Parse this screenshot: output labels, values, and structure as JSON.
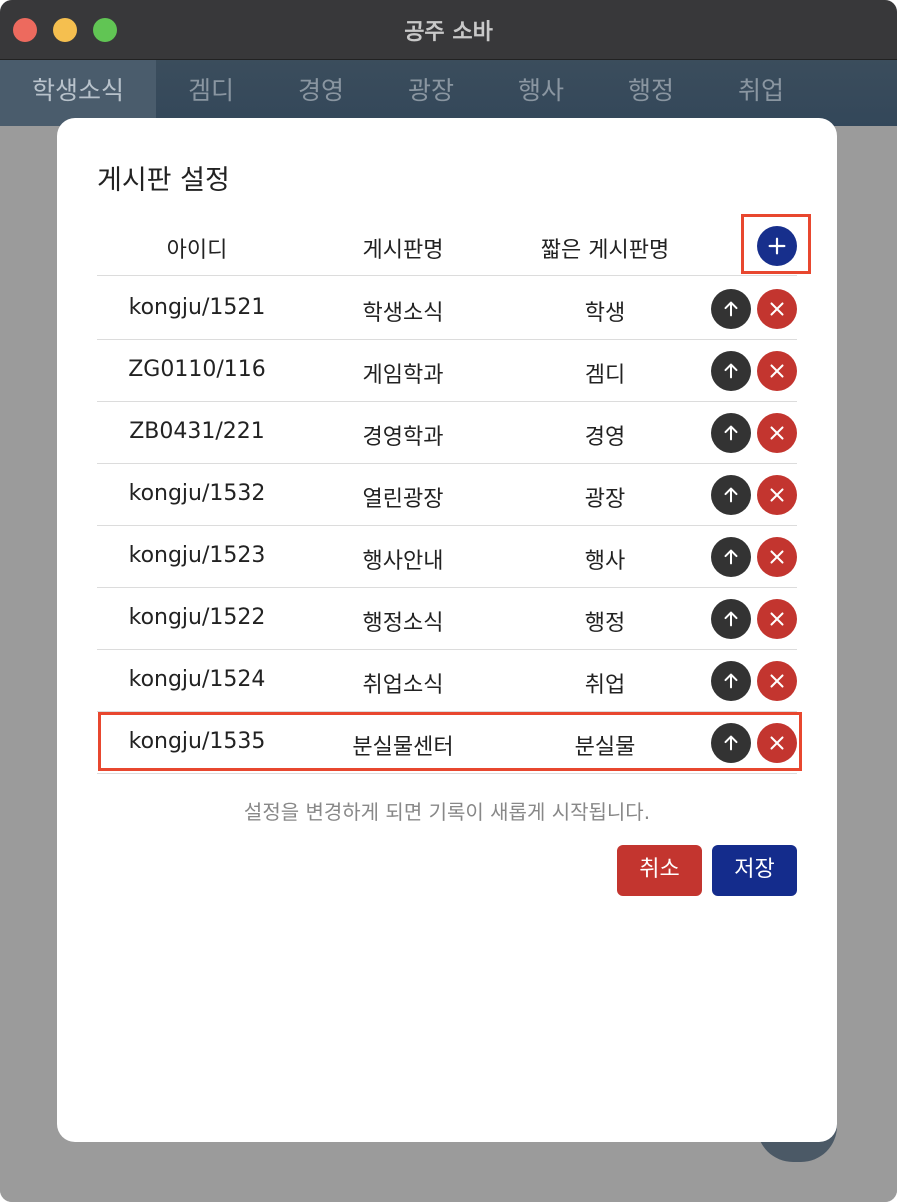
{
  "window": {
    "title": "공주 소바"
  },
  "tabs": [
    "학생소식",
    "겜디",
    "경영",
    "광장",
    "행사",
    "행정",
    "취업"
  ],
  "dialog": {
    "title": "게시판 설정",
    "columns": {
      "id": "아이디",
      "name": "게시판명",
      "short": "짧은 게시판명"
    },
    "rows": [
      {
        "id": "kongju/1521",
        "name": "학생소식",
        "short": "학생"
      },
      {
        "id": "ZG0110/116",
        "name": "게임학과",
        "short": "겜디"
      },
      {
        "id": "ZB0431/221",
        "name": "경영학과",
        "short": "경영"
      },
      {
        "id": "kongju/1532",
        "name": "열린광장",
        "short": "광장"
      },
      {
        "id": "kongju/1523",
        "name": "행사안내",
        "short": "행사"
      },
      {
        "id": "kongju/1522",
        "name": "행정소식",
        "short": "행정"
      },
      {
        "id": "kongju/1524",
        "name": "취업소식",
        "short": "취업"
      },
      {
        "id": "kongju/1535",
        "name": "분실물센터",
        "short": "분실물"
      }
    ],
    "notice": "설정을 변경하게 되면 기록이 새롭게 시작됩니다.",
    "cancel_label": "취소",
    "save_label": "저장"
  },
  "colors": {
    "accent_blue": "#142c8c",
    "danger_red": "#c3352f",
    "highlight": "#e8472f"
  }
}
